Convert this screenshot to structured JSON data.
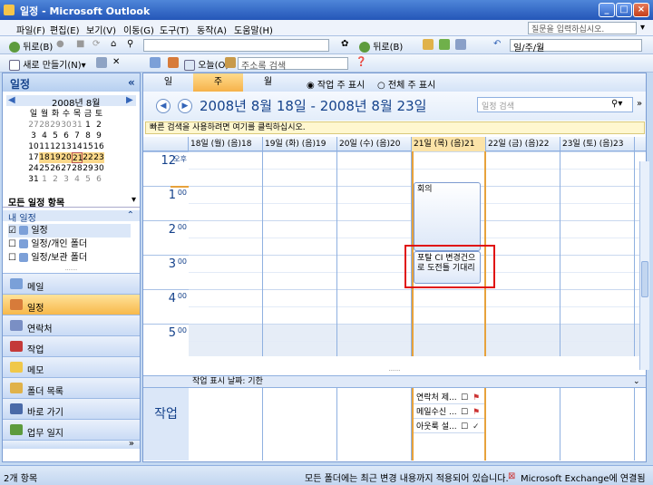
{
  "window": {
    "title": "일정 - Microsoft Outlook"
  },
  "menu": [
    "파일(F)",
    "편집(E)",
    "보기(V)",
    "이동(G)",
    "도구(T)",
    "동작(A)",
    "도움말(H)"
  ],
  "help_search": {
    "placeholder": "질문을 입력하십시오."
  },
  "toolbar1": {
    "back": "뒤로(B)",
    "back2": "뒤로(B)",
    "view_select": "일/주/월"
  },
  "toolbar2": {
    "new": "새로 만들기(N)",
    "today": "오늘(O)",
    "addressbook_placeholder": "주소록 검색"
  },
  "nav": {
    "title": "일정",
    "mini_cal": {
      "month": "2008년 8월",
      "weekdays": [
        "일",
        "월",
        "화",
        "수",
        "목",
        "금",
        "토"
      ],
      "weeks": [
        [
          "27",
          "28",
          "29",
          "30",
          "31",
          "1",
          "2"
        ],
        [
          "3",
          "4",
          "5",
          "6",
          "7",
          "8",
          "9"
        ],
        [
          "10",
          "11",
          "12",
          "13",
          "14",
          "15",
          "16"
        ],
        [
          "17",
          "18",
          "19",
          "20",
          "21",
          "22",
          "23"
        ],
        [
          "24",
          "25",
          "26",
          "27",
          "28",
          "29",
          "30"
        ],
        [
          "31",
          "1",
          "2",
          "3",
          "4",
          "5",
          "6"
        ]
      ]
    },
    "all_items": "모든 일정 항목",
    "my_cal": "내 일정",
    "calendars": [
      "일정",
      "일정/개인 폴더",
      "일정/보관 폴더"
    ],
    "buttons": [
      "메일",
      "일정",
      "연락처",
      "작업",
      "메모",
      "폴더 목록",
      "바로 가기",
      "업무 일지"
    ]
  },
  "view": {
    "tabs": [
      "일",
      "주",
      "월"
    ],
    "active_tab": "주",
    "radio_work": "작업 주 표시",
    "radio_full": "전체 주 표시",
    "date_range": "2008년 8월 18일 - 2008년 8월 23일",
    "search_placeholder": "일정 검색",
    "info": "빠른 검색을 사용하려면 여기를 클릭하십시오.",
    "days": [
      "18일 (월) (음)18",
      "19일 (화) (음)19",
      "20일 (수) (음)20",
      "21일 (목) (음)21",
      "22일 (금) (음)22",
      "23일 (토) (음)23"
    ],
    "hours": [
      {
        "h": "12",
        "ampm": "오후"
      },
      {
        "h": "1",
        "ampm": "00"
      },
      {
        "h": "2",
        "ampm": "00"
      },
      {
        "h": "3",
        "ampm": "00"
      },
      {
        "h": "4",
        "ampm": "00"
      },
      {
        "h": "5",
        "ampm": "00"
      }
    ],
    "appointments": [
      {
        "text": "회의"
      },
      {
        "text": "포탈 CI 변경건으로 도전틀 기대리"
      }
    ],
    "task_header": "작업 표시 날짜: 기한",
    "task_label": "작업",
    "tasks": [
      "연락처 제...",
      "메일수신 ...",
      "아웃룩 설..."
    ]
  },
  "status": {
    "left": "2개 항목",
    "mid": "모든 폴더에는 최근 변경 내용까지 적용되어 있습니다.",
    "exchange": "Microsoft Exchange에 연결됨"
  }
}
